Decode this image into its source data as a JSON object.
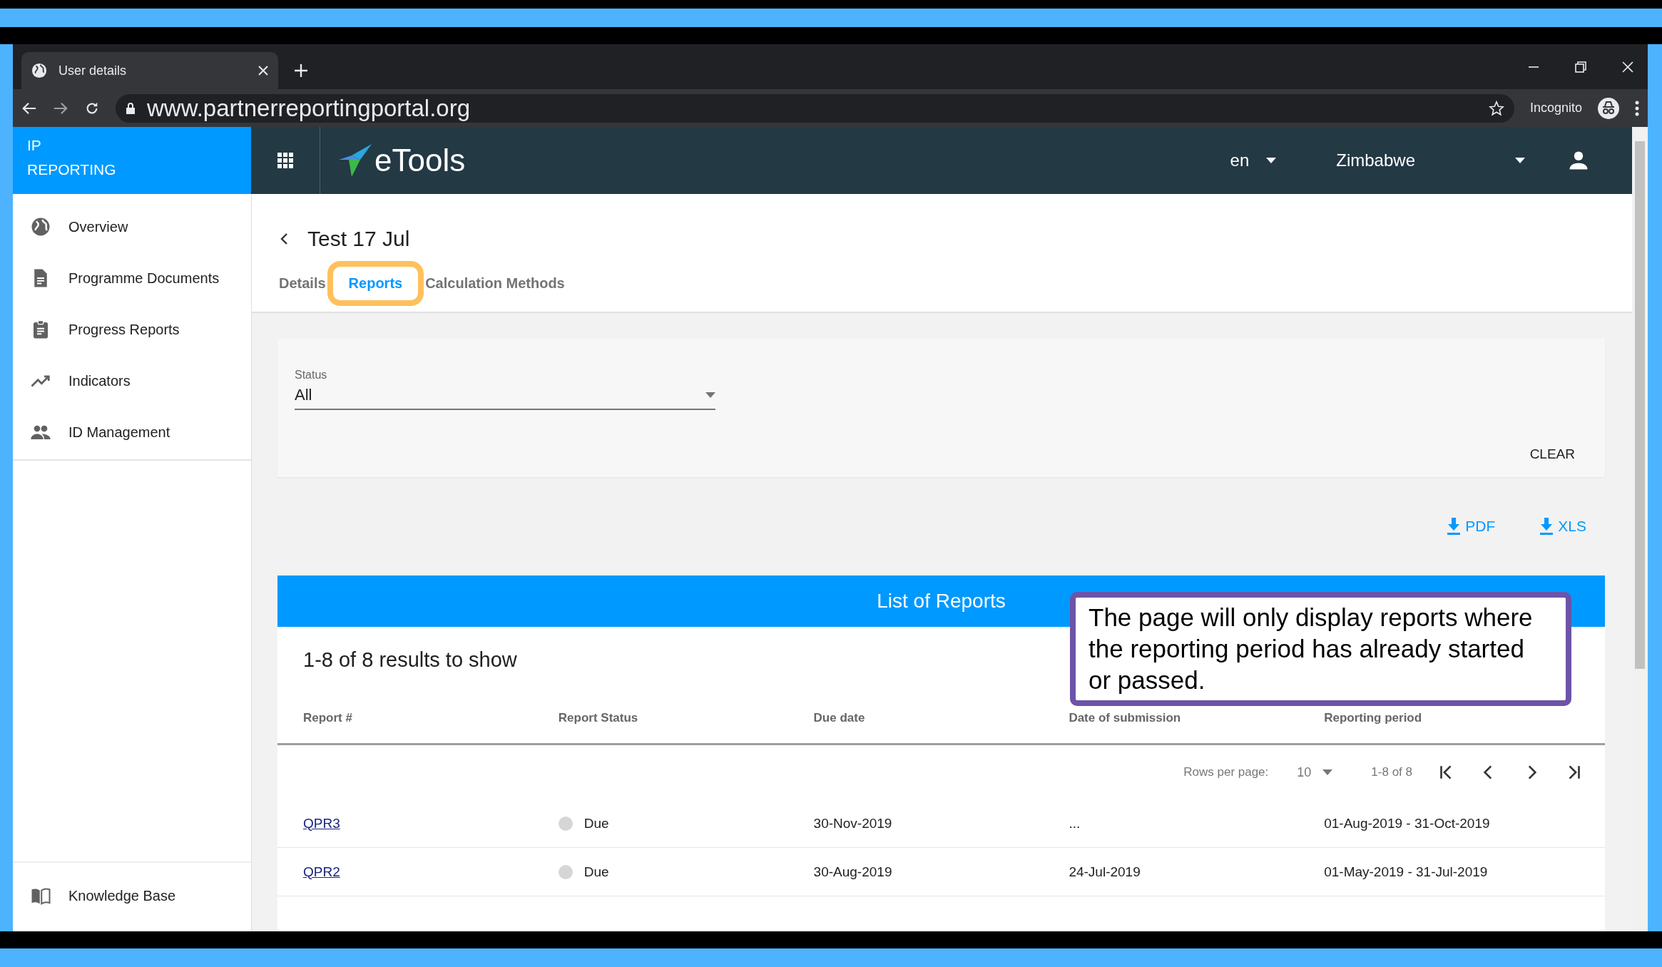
{
  "browser": {
    "tab_title": "User details",
    "url": "www.partnerreportingportal.org",
    "profile": "Incognito"
  },
  "app_header": {
    "brand_lines": [
      "IP",
      "REPORTING"
    ],
    "logo_text": "eTools",
    "language": "en",
    "country": "Zimbabwe"
  },
  "sidebar": {
    "items": [
      {
        "label": "Overview",
        "kind": "globe"
      },
      {
        "label": "Programme Documents",
        "kind": "document"
      },
      {
        "label": "Progress Reports",
        "kind": "clipboard"
      },
      {
        "label": "Indicators",
        "kind": "trend"
      },
      {
        "label": "ID Management",
        "kind": "people"
      }
    ],
    "footer_item": {
      "label": "Knowledge Base",
      "kind": "book"
    }
  },
  "page": {
    "title": "Test 17 Jul",
    "tabs": [
      {
        "label": "Details",
        "selected": false,
        "highlighted": false
      },
      {
        "label": "Reports",
        "selected": true,
        "highlighted": true
      },
      {
        "label": "Calculation Methods",
        "selected": false,
        "highlighted": false
      }
    ],
    "filter": {
      "label": "Status",
      "value": "All",
      "clear": "CLEAR"
    },
    "exports": [
      "PDF",
      "XLS"
    ],
    "table": {
      "title": "List of Reports",
      "summary": "1-8 of 8 results to show",
      "columns": [
        "Report #",
        "Report Status",
        "Due date",
        "Date of submission",
        "Reporting period"
      ],
      "pagination": {
        "rows_per_page_label": "Rows per page:",
        "rows_per_page": "10",
        "range": "1-8 of 8"
      },
      "rows": [
        {
          "report": "QPR3",
          "status": "Due",
          "color": "#d6d6d6",
          "due_date": "30-Nov-2019",
          "submission": "...",
          "period": "01-Aug-2019 - 31-Oct-2019"
        },
        {
          "report": "QPR2",
          "status": "Due",
          "color": "#d6d6d6",
          "due_date": "30-Aug-2019",
          "submission": "24-Jul-2019",
          "period": "01-May-2019 - 31-Jul-2019"
        }
      ]
    }
  },
  "callout": {
    "text": "The page will only display reports where the reporting period has already started or passed."
  }
}
